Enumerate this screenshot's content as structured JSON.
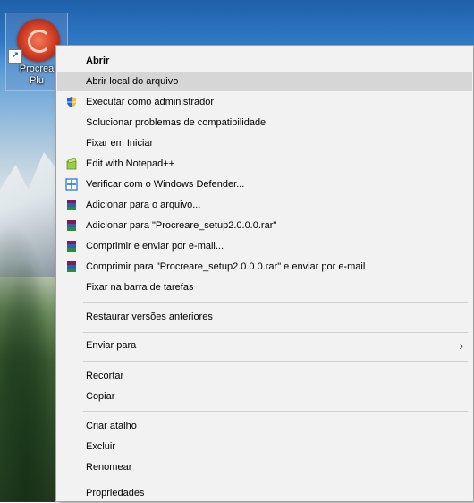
{
  "desktop": {
    "shortcut_label_line1": "Procrea",
    "shortcut_label_line2": "Plu",
    "shortcut_icon": "procreate-logo-icon"
  },
  "menu": {
    "items": [
      {
        "label": "Abrir",
        "bold": true
      },
      {
        "label": "Abrir local do arquivo",
        "hover": true
      },
      {
        "label": "Executar como administrador",
        "icon": "shield-icon"
      },
      {
        "label": "Solucionar problemas de compatibilidade"
      },
      {
        "label": "Fixar em Iniciar"
      },
      {
        "label": "Edit with Notepad++",
        "icon": "notepad-plus-plus-icon"
      },
      {
        "label": "Verificar com o Windows Defender...",
        "icon": "windows-defender-icon"
      },
      {
        "label": "Adicionar para o arquivo...",
        "icon": "winrar-icon"
      },
      {
        "label": "Adicionar para \"Procreare_setup2.0.0.0.rar\"",
        "icon": "winrar-icon"
      },
      {
        "label": "Comprimir e enviar por e-mail...",
        "icon": "winrar-icon"
      },
      {
        "label": "Comprimir para \"Procreare_setup2.0.0.0.rar\" e enviar por e-mail",
        "icon": "winrar-icon"
      },
      {
        "label": "Fixar na barra de tarefas"
      },
      {
        "label": "Restaurar versões anteriores"
      },
      {
        "label": "Enviar para",
        "submenu": true
      },
      {
        "label": "Recortar"
      },
      {
        "label": "Copiar"
      },
      {
        "label": "Criar atalho"
      },
      {
        "label": "Excluir"
      },
      {
        "label": "Renomear"
      },
      {
        "label": "Propriedades"
      }
    ],
    "submenu_glyph": "›"
  },
  "colors": {
    "menu_bg": "#f2f2f2",
    "hover_bg": "#d6d6d6",
    "separator": "#cfcfcf"
  }
}
